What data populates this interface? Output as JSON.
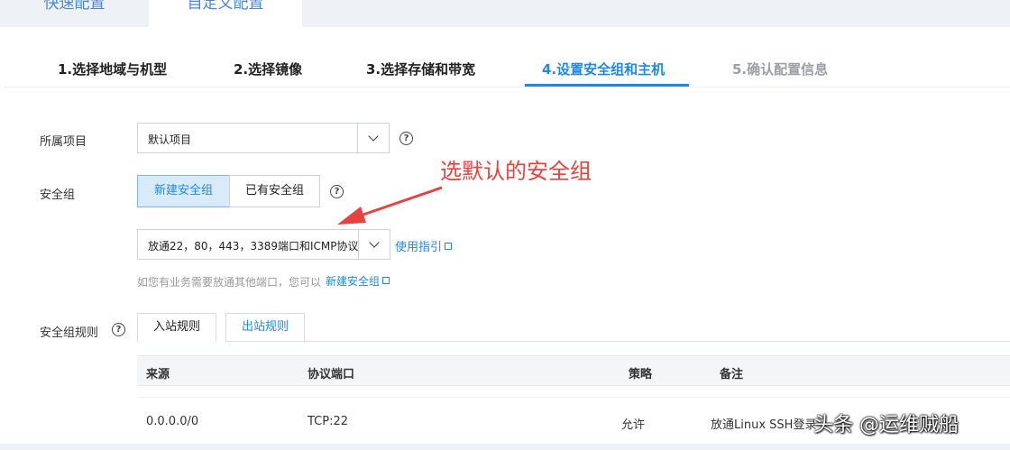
{
  "top_tabs": {
    "quick": "快速配置",
    "custom": "自定义配置"
  },
  "steps": [
    {
      "label": "1.选择地域与机型",
      "state": "done"
    },
    {
      "label": "2.选择镜像",
      "state": "done"
    },
    {
      "label": "3.选择存储和带宽",
      "state": "done"
    },
    {
      "label": "4.设置安全组和主机",
      "state": "active"
    },
    {
      "label": "5.确认配置信息",
      "state": "disabled"
    }
  ],
  "project": {
    "label": "所属项目",
    "value": "默认项目"
  },
  "security_group": {
    "label": "安全组",
    "new_button": "新建安全组",
    "existing_button": "已有安全组",
    "selected_value": "放通22，80，443，3389端口和ICMP协议",
    "guide_link": "使用指引",
    "hint": "如您有业务需要放通其他端口，您可以",
    "hint_link": "新建安全组"
  },
  "rules": {
    "label": "安全组规则",
    "tabs": [
      "入站规则",
      "出站规则"
    ],
    "columns": [
      "来源",
      "协议端口",
      "策略",
      "备注"
    ],
    "rows": [
      {
        "source": "0.0.0.0/0",
        "port": "TCP:22",
        "policy": "允许",
        "note": "放通Linux SSH登录"
      }
    ]
  },
  "annotation": "选默认的安全组",
  "watermark": "头条 @运维贼船",
  "colors": {
    "accent": "#1f88e5",
    "annotation": "#e8423f"
  }
}
